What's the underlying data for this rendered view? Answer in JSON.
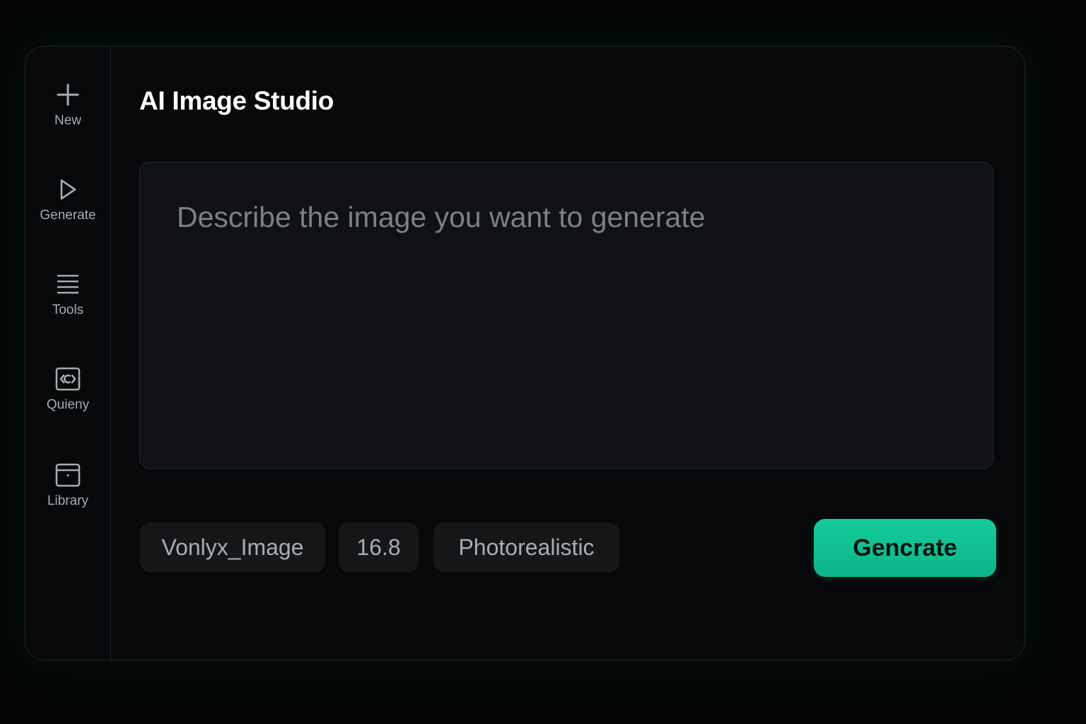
{
  "app": {
    "title": "AI Image Studio"
  },
  "sidebar": {
    "items": [
      {
        "label": "New",
        "icon": "plus-icon"
      },
      {
        "label": "Generate",
        "icon": "play-icon"
      },
      {
        "label": "Tools",
        "icon": "menu-lines-icon"
      },
      {
        "label": "Quieny",
        "icon": "code-frame-icon"
      },
      {
        "label": "Library",
        "icon": "archive-icon"
      }
    ]
  },
  "prompt": {
    "placeholder": "Describe the image you want to generate",
    "value": ""
  },
  "options": {
    "model": "Vonlyx_Image",
    "ratio": "16.8",
    "style": "Photorealistic"
  },
  "actions": {
    "generate_label": "Gencrate"
  },
  "colors": {
    "accent": "#12c496",
    "background": "#06080a",
    "chip_background": "#151618"
  }
}
